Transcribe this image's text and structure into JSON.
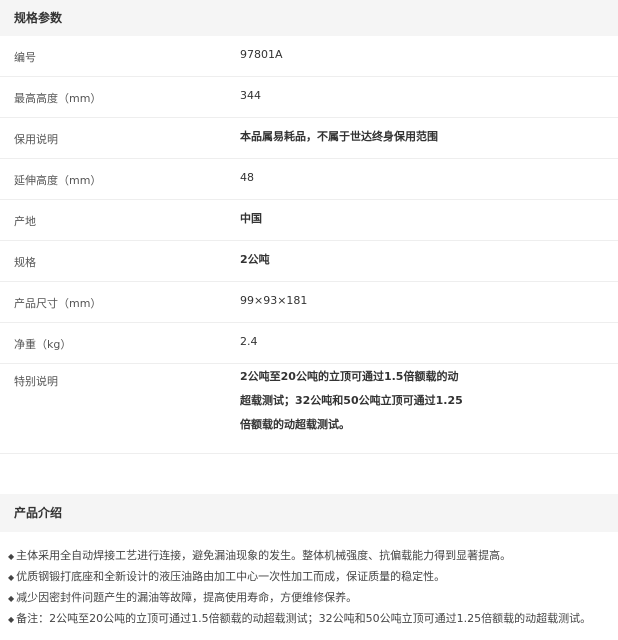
{
  "spec_section": {
    "title": "规格参数",
    "rows": [
      {
        "label": "编号",
        "value": "97801A",
        "bold": false
      },
      {
        "label": "最高高度（mm）",
        "value": "344",
        "bold": false
      },
      {
        "label": "保用说明",
        "value": "本品属易耗品，不属于世达终身保用范围",
        "bold": true
      },
      {
        "label": "延伸高度（mm）",
        "value": "48",
        "bold": false
      },
      {
        "label": "产地",
        "value": "中国",
        "bold": true
      },
      {
        "label": "规格",
        "value": "2公吨",
        "bold": true
      },
      {
        "label": "产品尺寸（mm）",
        "value": "99×93×181",
        "bold": false
      },
      {
        "label": "净重（kg）",
        "value": "2.4",
        "bold": false
      },
      {
        "label": "特别说明",
        "value_lines": [
          "2公吨至20公吨的立顶可通过1.5倍额载的动",
          "超载测试；32公吨和50公吨立顶可通过1.25",
          "倍额载的动超载测试。"
        ],
        "bold": true
      }
    ]
  },
  "intro_section": {
    "title": "产品介绍",
    "bullet_symbol": "◆",
    "items": [
      "主体采用全自动焊接工艺进行连接，避免漏油现象的发生。整体机械强度、抗偏载能力得到显著提高。",
      "优质钢锻打底座和全新设计的液压油路由加工中心一次性加工而成，保证质量的稳定性。",
      "减少因密封件问题产生的漏油等故障，提高使用寿命，方便维修保养。",
      "备注：2公吨至20公吨的立顶可通过1.5倍额载的动超载测试；32公吨和50公吨立顶可通过1.25倍额载的动超载测试。"
    ]
  }
}
